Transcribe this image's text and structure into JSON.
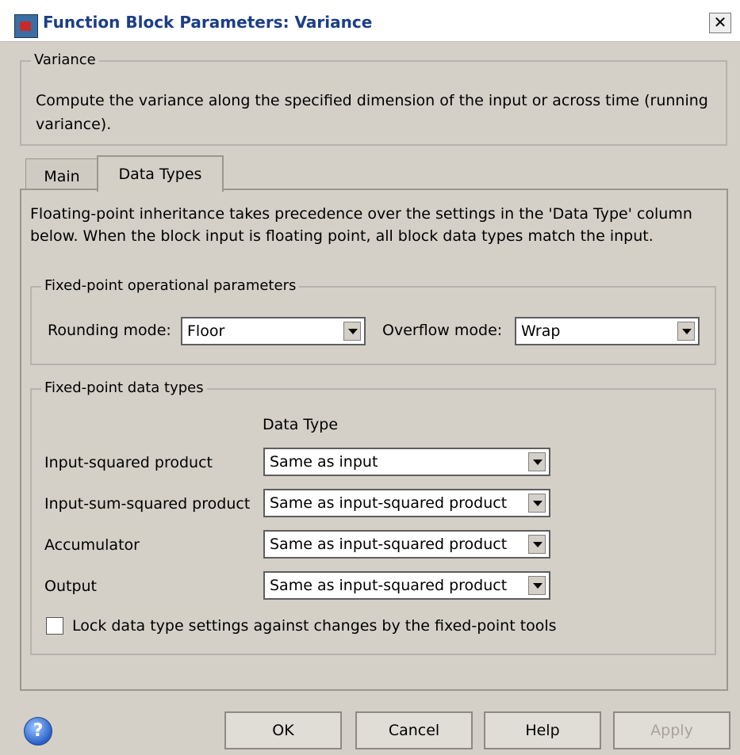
{
  "window": {
    "title": "Function Block Parameters: Variance",
    "close_label": "✕"
  },
  "description_group": {
    "legend": "Variance",
    "text": "Compute the variance along the specified dimension of the input or across time (running variance)."
  },
  "tabs": [
    {
      "label": "Main"
    },
    {
      "label": "Data Types"
    }
  ],
  "note": "Floating-point inheritance takes precedence over the settings in the 'Data Type' column below. When the block input is floating point, all block data types match the input.",
  "fixed_point_params": {
    "legend": "Fixed-point operational parameters",
    "rounding_label": "Rounding mode:",
    "rounding_value": "Floor",
    "overflow_label": "Overflow mode:",
    "overflow_value": "Wrap"
  },
  "data_types": {
    "legend": "Fixed-point data types",
    "column_header": "Data Type",
    "rows": [
      {
        "label": "Input-squared product",
        "value": "Same as input"
      },
      {
        "label": "Input-sum-squared product",
        "value": "Same as input-squared product"
      },
      {
        "label": "Accumulator",
        "value": "Same as input-squared product"
      },
      {
        "label": "Output",
        "value": "Same as input-squared product"
      }
    ],
    "lock_label": "Lock data type settings against changes by the fixed-point tools",
    "lock_checked": false
  },
  "buttons": {
    "ok": "OK",
    "cancel": "Cancel",
    "help": "Help",
    "apply": "Apply"
  },
  "help_icon_text": "?"
}
